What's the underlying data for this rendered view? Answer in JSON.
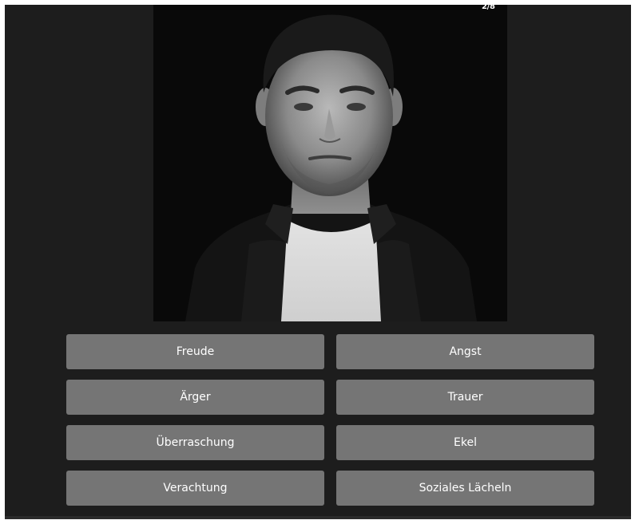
{
  "quiz": {
    "progress": "2/8",
    "photo_icon": "portrait-photo",
    "options": [
      {
        "label": "Freude"
      },
      {
        "label": "Angst"
      },
      {
        "label": "Ärger"
      },
      {
        "label": "Trauer"
      },
      {
        "label": "Überraschung"
      },
      {
        "label": "Ekel"
      },
      {
        "label": "Verachtung"
      },
      {
        "label": "Soziales Lächeln"
      }
    ]
  },
  "colors": {
    "background": "#1d1d1d",
    "button": "#757575",
    "button_text": "#ffffff"
  }
}
